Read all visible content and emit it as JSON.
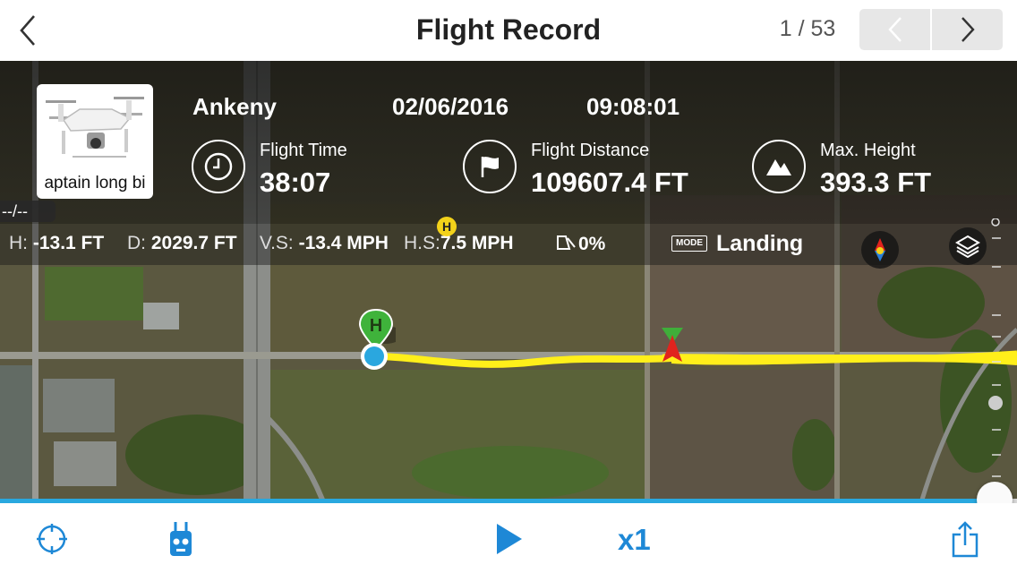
{
  "header": {
    "title": "Flight Record",
    "counter": "1 / 53",
    "back_icon": "chevron-left-icon",
    "prev_icon": "chevron-left-icon",
    "next_icon": "chevron-right-icon"
  },
  "flight": {
    "drone_name": "aptain long bi",
    "location": "Ankeny",
    "date": "02/06/2016",
    "time": "09:08:01",
    "metrics": [
      {
        "label": "Flight Time",
        "value": "38:07",
        "icon": "clock-icon"
      },
      {
        "label": "Flight Distance",
        "value": "109607.4 FT",
        "icon": "flag-icon"
      },
      {
        "label": "Max. Height",
        "value": "393.3 FT",
        "icon": "mountain-icon"
      }
    ],
    "coords": "--/--"
  },
  "telemetry": {
    "h_label": "H:",
    "h_value": "-13.1 FT",
    "d_label": "D:",
    "d_value": "2029.7 FT",
    "vs_label": "V.S:",
    "vs_value": "-13.4 MPH",
    "hs_label": "H.S:",
    "hs_value": "7.5 MPH",
    "gimbal_value": "0%",
    "mode_badge": "MODE",
    "mode_value": "Landing",
    "home_marker": "H"
  },
  "playback": {
    "speed": "x1",
    "progress": 0.98
  },
  "colors": {
    "accent": "#29a8df",
    "flight_path": "#ffef1a",
    "home_marker": "#3fb33b",
    "aircraft": "#e0231e"
  }
}
